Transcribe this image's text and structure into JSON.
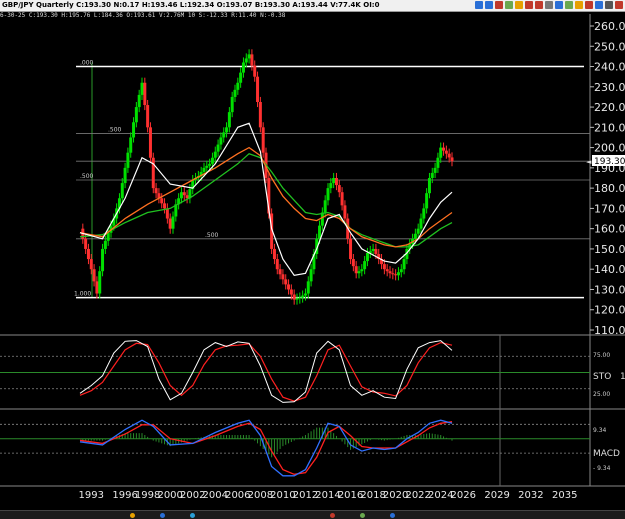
{
  "window": {
    "title": "GBP/JPY Quarterly C:193.30 N:0.17 H:193.46 L:192.34 O:193.07 B:193.30 A:193.44 V:77.4K OI:0",
    "info_line": "6-30-25 C:193.30 H:195.76 L:184.36 O:193.61 V:2.76M 10 S:-12.33 R:11.40 N:-0.38"
  },
  "toolbar": {
    "icons": [
      {
        "name": "refresh-icon",
        "color": "#2a6fd6"
      },
      {
        "name": "zoom-icon",
        "color": "#2a6fd6"
      },
      {
        "name": "rocket-icon",
        "color": "#c0392b"
      },
      {
        "name": "pencil-icon",
        "color": "#6aa84f"
      },
      {
        "name": "draw-line-icon",
        "color": "#e6a000"
      },
      {
        "name": "bar-icon",
        "color": "#c0392b"
      },
      {
        "name": "stop-icon",
        "color": "#c0392b"
      },
      {
        "name": "lock-icon",
        "color": "#777777"
      },
      {
        "name": "trend-icon",
        "color": "#2a6fd6"
      },
      {
        "name": "fib-icon",
        "color": "#6aa84f"
      },
      {
        "name": "star-icon",
        "color": "#e6a000"
      },
      {
        "name": "rect-icon",
        "color": "#c0392b"
      },
      {
        "name": "line-icon",
        "color": "#2a6fd6"
      },
      {
        "name": "grid-icon",
        "color": "#555555"
      },
      {
        "name": "close-icon",
        "color": "#c0392b"
      }
    ]
  },
  "chart_data": {
    "type": "candlestick",
    "symbol": "GBP/JPY",
    "period": "Quarterly",
    "last_price_label": "193.30",
    "price_axis": {
      "min": 110,
      "max": 260,
      "ticks": [
        "260.00",
        "250.00",
        "240.00",
        "230.00",
        "220.00",
        "210.00",
        "200.00",
        "190.00",
        "180.00",
        "170.00",
        "160.00",
        "150.00",
        "140.00",
        "130.00",
        "120.00",
        "110.00"
      ]
    },
    "year_ticks": [
      {
        "label": "1993",
        "year": 1993
      },
      {
        "label": "1996",
        "year": 1996
      },
      {
        "label": "1998",
        "year": 1998
      },
      {
        "label": "2000",
        "year": 2000
      },
      {
        "label": "2002",
        "year": 2002
      },
      {
        "label": "2004",
        "year": 2004
      },
      {
        "label": "2006",
        "year": 2006
      },
      {
        "label": "2008",
        "year": 2008
      },
      {
        "label": "2010",
        "year": 2010
      },
      {
        "label": "2012",
        "year": 2012
      },
      {
        "label": "2014",
        "year": 2014
      },
      {
        "label": "2016",
        "year": 2016
      },
      {
        "label": "2018",
        "year": 2018
      },
      {
        "label": "2020",
        "year": 2020
      },
      {
        "label": "2022",
        "year": 2022
      },
      {
        "label": "2024",
        "year": 2024
      },
      {
        "label": "2026",
        "year": 2026
      },
      {
        "label": "2029",
        "year": 2029
      },
      {
        "label": "2032",
        "year": 2032
      },
      {
        "label": "2035",
        "year": 2035
      }
    ],
    "fib_lines": [
      {
        "label": ".000",
        "price": 240.0
      },
      {
        "label": ".500",
        "price": 207.0
      },
      {
        "label": "",
        "price": 193.3
      },
      {
        "label": ".500",
        "price": 184.0
      },
      {
        "label": ".500",
        "price": 155.0
      },
      {
        "label": "1.000",
        "price": 126.0
      }
    ],
    "price_path": [
      [
        1992.0,
        160
      ],
      [
        1992.5,
        150
      ],
      [
        1993.0,
        140
      ],
      [
        1993.5,
        128
      ],
      [
        1994.0,
        150
      ],
      [
        1994.5,
        158
      ],
      [
        1995.0,
        165
      ],
      [
        1995.5,
        175
      ],
      [
        1996.0,
        190
      ],
      [
        1996.5,
        205
      ],
      [
        1997.0,
        220
      ],
      [
        1997.5,
        232
      ],
      [
        1998.0,
        210
      ],
      [
        1998.5,
        180
      ],
      [
        1999.0,
        175
      ],
      [
        1999.5,
        170
      ],
      [
        2000.0,
        160
      ],
      [
        2000.5,
        172
      ],
      [
        2001.0,
        178
      ],
      [
        2001.5,
        175
      ],
      [
        2002.0,
        184
      ],
      [
        2002.5,
        186
      ],
      [
        2003.0,
        190
      ],
      [
        2003.5,
        192
      ],
      [
        2004.0,
        198
      ],
      [
        2004.5,
        205
      ],
      [
        2005.0,
        210
      ],
      [
        2005.5,
        225
      ],
      [
        2006.0,
        232
      ],
      [
        2006.5,
        242
      ],
      [
        2007.0,
        246
      ],
      [
        2007.5,
        235
      ],
      [
        2008.0,
        210
      ],
      [
        2008.5,
        185
      ],
      [
        2009.0,
        150
      ],
      [
        2009.5,
        140
      ],
      [
        2010.0,
        135
      ],
      [
        2010.5,
        130
      ],
      [
        2011.0,
        125
      ],
      [
        2011.5,
        126
      ],
      [
        2012.0,
        128
      ],
      [
        2012.5,
        140
      ],
      [
        2013.0,
        155
      ],
      [
        2013.5,
        168
      ],
      [
        2014.0,
        180
      ],
      [
        2014.5,
        185
      ],
      [
        2015.0,
        178
      ],
      [
        2015.5,
        165
      ],
      [
        2016.0,
        145
      ],
      [
        2016.5,
        138
      ],
      [
        2017.0,
        140
      ],
      [
        2017.5,
        148
      ],
      [
        2018.0,
        150
      ],
      [
        2018.5,
        145
      ],
      [
        2019.0,
        140
      ],
      [
        2019.5,
        138
      ],
      [
        2020.0,
        137
      ],
      [
        2020.5,
        140
      ],
      [
        2021.0,
        150
      ],
      [
        2021.5,
        155
      ],
      [
        2022.0,
        160
      ],
      [
        2022.5,
        170
      ],
      [
        2023.0,
        185
      ],
      [
        2023.5,
        190
      ],
      [
        2024.0,
        200
      ],
      [
        2024.5,
        197
      ],
      [
        2025.0,
        193.3
      ]
    ],
    "ma_fast": [
      [
        1992.0,
        158
      ],
      [
        1994.0,
        155
      ],
      [
        1996.0,
        175
      ],
      [
        1997.5,
        195
      ],
      [
        1998.5,
        192
      ],
      [
        2000.0,
        182
      ],
      [
        2002.0,
        180
      ],
      [
        2004.0,
        192
      ],
      [
        2006.0,
        210
      ],
      [
        2007.0,
        212
      ],
      [
        2008.0,
        198
      ],
      [
        2009.0,
        160
      ],
      [
        2010.0,
        145
      ],
      [
        2011.0,
        137
      ],
      [
        2012.0,
        138
      ],
      [
        2013.0,
        150
      ],
      [
        2014.0,
        165
      ],
      [
        2015.0,
        167
      ],
      [
        2016.0,
        158
      ],
      [
        2017.0,
        150
      ],
      [
        2018.0,
        147
      ],
      [
        2019.0,
        144
      ],
      [
        2020.0,
        143
      ],
      [
        2021.0,
        148
      ],
      [
        2022.0,
        155
      ],
      [
        2023.0,
        165
      ],
      [
        2024.0,
        173
      ],
      [
        2025.0,
        178
      ]
    ],
    "ma_mid": [
      [
        1992.0,
        158
      ],
      [
        1994.0,
        156
      ],
      [
        1996.0,
        165
      ],
      [
        1998.0,
        172
      ],
      [
        2000.0,
        178
      ],
      [
        2002.0,
        184
      ],
      [
        2004.0,
        190
      ],
      [
        2006.0,
        197
      ],
      [
        2007.0,
        200
      ],
      [
        2008.0,
        196
      ],
      [
        2009.0,
        185
      ],
      [
        2010.0,
        176
      ],
      [
        2011.0,
        170
      ],
      [
        2012.0,
        165
      ],
      [
        2013.0,
        164
      ],
      [
        2014.0,
        167
      ],
      [
        2015.0,
        165
      ],
      [
        2016.0,
        160
      ],
      [
        2017.0,
        156
      ],
      [
        2018.0,
        154
      ],
      [
        2019.0,
        152
      ],
      [
        2020.0,
        151
      ],
      [
        2021.0,
        152
      ],
      [
        2022.0,
        155
      ],
      [
        2023.0,
        160
      ],
      [
        2024.0,
        164
      ],
      [
        2025.0,
        168
      ]
    ],
    "ma_slow": [
      [
        1992.0,
        156
      ],
      [
        1994.0,
        157
      ],
      [
        1996.0,
        163
      ],
      [
        1998.0,
        168
      ],
      [
        2000.0,
        170
      ],
      [
        2002.0,
        176
      ],
      [
        2004.0,
        184
      ],
      [
        2006.0,
        192
      ],
      [
        2007.0,
        197
      ],
      [
        2008.0,
        195
      ],
      [
        2009.0,
        188
      ],
      [
        2010.0,
        180
      ],
      [
        2011.0,
        174
      ],
      [
        2012.0,
        168
      ],
      [
        2013.0,
        167
      ],
      [
        2014.0,
        168
      ],
      [
        2015.0,
        166
      ],
      [
        2016.0,
        160
      ],
      [
        2017.0,
        157
      ],
      [
        2018.0,
        155
      ],
      [
        2019.0,
        153
      ],
      [
        2020.0,
        151
      ],
      [
        2021.0,
        151
      ],
      [
        2022.0,
        152
      ],
      [
        2023.0,
        156
      ],
      [
        2024.0,
        160
      ],
      [
        2025.0,
        163
      ]
    ],
    "sto_panel": {
      "label": "STO",
      "label_suffix": "1",
      "levels": [
        "75.00",
        "25.00"
      ],
      "k": [
        [
          1992,
          18
        ],
        [
          1993,
          30
        ],
        [
          1994,
          45
        ],
        [
          1995,
          80
        ],
        [
          1996,
          98
        ],
        [
          1997,
          99
        ],
        [
          1998,
          90
        ],
        [
          1999,
          40
        ],
        [
          2000,
          8
        ],
        [
          2001,
          18
        ],
        [
          2002,
          50
        ],
        [
          2003,
          85
        ],
        [
          2004,
          96
        ],
        [
          2005,
          90
        ],
        [
          2006,
          97
        ],
        [
          2007,
          95
        ],
        [
          2008,
          60
        ],
        [
          2009,
          15
        ],
        [
          2010,
          4
        ],
        [
          2011,
          5
        ],
        [
          2012,
          20
        ],
        [
          2013,
          80
        ],
        [
          2014,
          98
        ],
        [
          2015,
          85
        ],
        [
          2016,
          30
        ],
        [
          2017,
          15
        ],
        [
          2018,
          22
        ],
        [
          2019,
          12
        ],
        [
          2020,
          10
        ],
        [
          2021,
          55
        ],
        [
          2022,
          88
        ],
        [
          2023,
          96
        ],
        [
          2024,
          99
        ],
        [
          2025,
          84
        ]
      ],
      "d": [
        [
          1992,
          15
        ],
        [
          1993,
          22
        ],
        [
          1994,
          35
        ],
        [
          1995,
          60
        ],
        [
          1996,
          85
        ],
        [
          1997,
          95
        ],
        [
          1998,
          93
        ],
        [
          1999,
          65
        ],
        [
          2000,
          30
        ],
        [
          2001,
          15
        ],
        [
          2002,
          30
        ],
        [
          2003,
          62
        ],
        [
          2004,
          85
        ],
        [
          2005,
          91
        ],
        [
          2006,
          92
        ],
        [
          2007,
          94
        ],
        [
          2008,
          75
        ],
        [
          2009,
          40
        ],
        [
          2010,
          12
        ],
        [
          2011,
          6
        ],
        [
          2012,
          12
        ],
        [
          2013,
          45
        ],
        [
          2014,
          85
        ],
        [
          2015,
          92
        ],
        [
          2016,
          60
        ],
        [
          2017,
          28
        ],
        [
          2018,
          20
        ],
        [
          2019,
          18
        ],
        [
          2020,
          14
        ],
        [
          2021,
          30
        ],
        [
          2022,
          65
        ],
        [
          2023,
          88
        ],
        [
          2024,
          96
        ],
        [
          2025,
          92
        ]
      ]
    },
    "macd_panel": {
      "label": "MACD",
      "levels": [
        "9.34",
        "- 9.34"
      ],
      "macd": [
        [
          1992,
          -2
        ],
        [
          1994,
          -4
        ],
        [
          1996,
          6
        ],
        [
          1997.5,
          12
        ],
        [
          1998.5,
          8
        ],
        [
          2000,
          -4
        ],
        [
          2002,
          -3
        ],
        [
          2004,
          4
        ],
        [
          2006,
          10
        ],
        [
          2007,
          12
        ],
        [
          2008,
          2
        ],
        [
          2009,
          -18
        ],
        [
          2010,
          -24
        ],
        [
          2011,
          -24
        ],
        [
          2012,
          -20
        ],
        [
          2013,
          -6
        ],
        [
          2014,
          10
        ],
        [
          2015,
          8
        ],
        [
          2016,
          -4
        ],
        [
          2017,
          -8
        ],
        [
          2018,
          -6
        ],
        [
          2019,
          -7
        ],
        [
          2020,
          -6
        ],
        [
          2021,
          0
        ],
        [
          2022,
          4
        ],
        [
          2023,
          10
        ],
        [
          2024,
          12
        ],
        [
          2025,
          10
        ]
      ],
      "signal": [
        [
          1992,
          -1
        ],
        [
          1994,
          -3
        ],
        [
          1996,
          3
        ],
        [
          1997.5,
          9
        ],
        [
          1998.5,
          9
        ],
        [
          2000,
          0
        ],
        [
          2002,
          -3
        ],
        [
          2004,
          2
        ],
        [
          2006,
          8
        ],
        [
          2007,
          10
        ],
        [
          2008,
          6
        ],
        [
          2009,
          -8
        ],
        [
          2010,
          -20
        ],
        [
          2011,
          -23
        ],
        [
          2012,
          -22
        ],
        [
          2013,
          -12
        ],
        [
          2014,
          4
        ],
        [
          2015,
          8
        ],
        [
          2016,
          2
        ],
        [
          2017,
          -5
        ],
        [
          2018,
          -6
        ],
        [
          2019,
          -6
        ],
        [
          2020,
          -6
        ],
        [
          2021,
          -2
        ],
        [
          2022,
          2
        ],
        [
          2023,
          7
        ],
        [
          2024,
          10
        ],
        [
          2025,
          11
        ]
      ]
    },
    "colors": {
      "up": "#00e000",
      "down": "#ff3030",
      "fast_ma": "#ffffff",
      "mid_ma": "#ff7020",
      "slow_ma": "#20c020",
      "sto_k": "#ffffff",
      "sto_d": "#ff2020",
      "macd": "#3070ff",
      "signal": "#ff2020",
      "grid": "#555555"
    }
  }
}
